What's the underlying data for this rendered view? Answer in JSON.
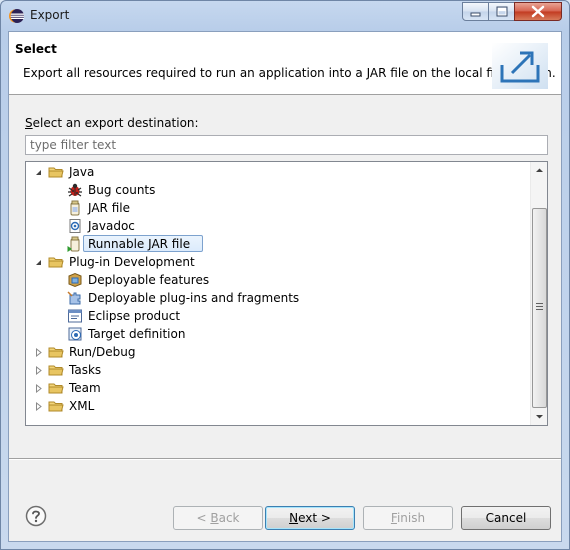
{
  "window": {
    "title": "Export"
  },
  "banner": {
    "title": "Select",
    "description": "Export all resources required to run an application into a JAR file on the local file system."
  },
  "destination": {
    "label_mnemonic": "S",
    "label_rest": "elect an export destination:",
    "filter_placeholder": "type filter text"
  },
  "tree": {
    "items": [
      {
        "label": "Java",
        "level": 0,
        "expanded": true,
        "icon": "folder-icon"
      },
      {
        "label": "Bug counts",
        "level": 1,
        "icon": "bug-icon"
      },
      {
        "label": "JAR file",
        "level": 1,
        "icon": "jar-icon"
      },
      {
        "label": "Javadoc",
        "level": 1,
        "icon": "javadoc-icon"
      },
      {
        "label": "Runnable JAR file",
        "level": 1,
        "icon": "runnable-jar-icon",
        "selected": true
      },
      {
        "label": "Plug-in Development",
        "level": 0,
        "expanded": true,
        "icon": "folder-icon"
      },
      {
        "label": "Deployable features",
        "level": 1,
        "icon": "feature-icon"
      },
      {
        "label": "Deployable plug-ins and fragments",
        "level": 1,
        "icon": "plugin-icon"
      },
      {
        "label": "Eclipse product",
        "level": 1,
        "icon": "product-icon"
      },
      {
        "label": "Target definition",
        "level": 1,
        "icon": "target-icon"
      },
      {
        "label": "Run/Debug",
        "level": 0,
        "expanded": false,
        "icon": "folder-icon"
      },
      {
        "label": "Tasks",
        "level": 0,
        "expanded": false,
        "icon": "folder-icon"
      },
      {
        "label": "Team",
        "level": 0,
        "expanded": false,
        "icon": "folder-icon"
      },
      {
        "label": "XML",
        "level": 0,
        "expanded": false,
        "icon": "folder-icon"
      }
    ]
  },
  "buttons": {
    "back_pre": "< ",
    "back_mnemonic": "B",
    "back_rest": "ack",
    "next_mnemonic": "N",
    "next_rest": "ext >",
    "finish_mnemonic": "F",
    "finish_rest": "inish",
    "cancel": "Cancel"
  },
  "colors": {
    "selection_border": "#7da2ce",
    "selection_fill": "#dcebfc",
    "folder": "#e8c562",
    "default_button_border": "#3c7fb1"
  }
}
